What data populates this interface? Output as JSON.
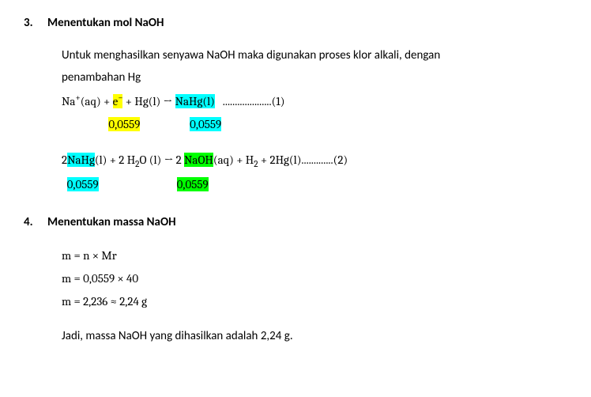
{
  "section3": {
    "num": "3.",
    "title": "Menentukan mol NaOH",
    "intro1": "Untuk menghasilkan senyawa NaOH maka digunakan proses klor alkali, dengan",
    "intro2": "penambahan Hg",
    "eq1": {
      "lhs_Na": "Na",
      "lhs_Na_sup": "+",
      "lhs_aq": "(aq) + ",
      "e": "e",
      "e_sup": "−",
      "plusHg": " + Hg(l) → ",
      "NaHg": "NaHg(l)",
      "dots": "   ....................(1)",
      "val_left": "0,0559",
      "val_right": "0,0559"
    },
    "eq2": {
      "coef2a": "2",
      "NaHg": "NaHg",
      "NaHg_l": "(l) + 2 H",
      "h2o_sub": "2",
      "h2o_tail": "O (l) → 2 ",
      "NaOH": "NaOH",
      "NaOH_tail": "(aq) + H",
      "h2_sub": "2",
      "plus2hg": " + 2Hg(l).............(2)",
      "val_left": "0,0559",
      "val_right": "0,0559"
    }
  },
  "section4": {
    "num": "4.",
    "title": "Menentukan massa NaOH",
    "line1": "m = n × Mr",
    "line2": "m = 0,0559 × 40",
    "line3": "m = 2,236  ≈ 2,24 g",
    "conclusion": "Jadi, massa NaOH yang dihasilkan adalah 2,24 g."
  }
}
